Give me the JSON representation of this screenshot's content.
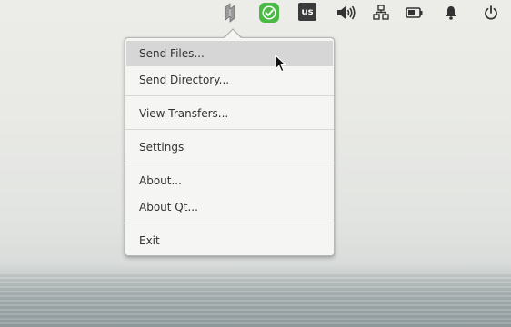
{
  "panel": {
    "keyboard_layout": "us",
    "indicators": [
      {
        "name": "app-tray-icon"
      },
      {
        "name": "check-icon",
        "color": "#4cb944"
      },
      {
        "name": "keyboard-layout"
      },
      {
        "name": "volume-icon"
      },
      {
        "name": "network-icon"
      },
      {
        "name": "battery-icon"
      },
      {
        "name": "notification-bell-icon"
      },
      {
        "name": "power-icon"
      }
    ]
  },
  "menu": {
    "items": [
      {
        "label": "Send Files..."
      },
      {
        "label": "Send Directory..."
      },
      {
        "label": "View Transfers..."
      },
      {
        "label": "Settings"
      },
      {
        "label": "About..."
      },
      {
        "label": "About Qt..."
      },
      {
        "label": "Exit"
      }
    ],
    "highlighted_index": 0
  },
  "colors": {
    "menu_bg": "#f5f5f4",
    "menu_hover": "#d6d6d6",
    "text": "#333333",
    "accent_green": "#4cb944"
  }
}
